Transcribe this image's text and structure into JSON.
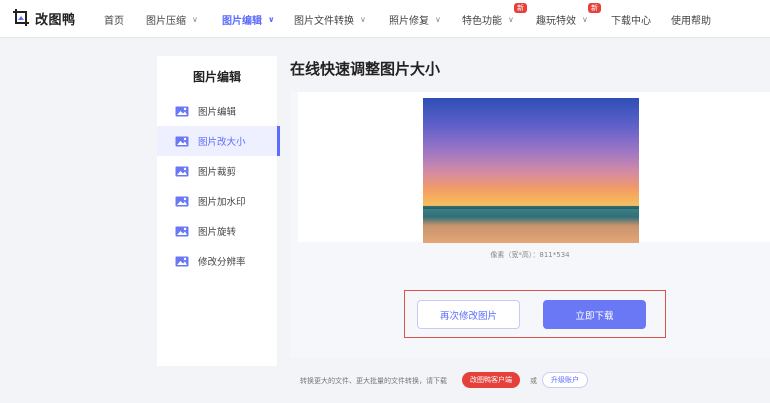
{
  "brand": {
    "name": "改图鸭"
  },
  "nav": [
    {
      "label": "首页",
      "has_menu": false
    },
    {
      "label": "图片压缩",
      "has_menu": true
    },
    {
      "label": "图片编辑",
      "has_menu": true,
      "active": true
    },
    {
      "label": "图片文件转换",
      "has_menu": true
    },
    {
      "label": "照片修复",
      "has_menu": true
    },
    {
      "label": "特色功能",
      "has_menu": true,
      "badge": "新"
    },
    {
      "label": "趣玩特效",
      "has_menu": true,
      "badge": "新"
    },
    {
      "label": "下载中心",
      "has_menu": false
    },
    {
      "label": "使用帮助",
      "has_menu": false
    }
  ],
  "sidebar": {
    "title": "图片编辑",
    "items": [
      {
        "label": "图片编辑",
        "icon": "image-icon"
      },
      {
        "label": "图片改大小",
        "icon": "image-icon",
        "active": true
      },
      {
        "label": "图片裁剪",
        "icon": "image-icon"
      },
      {
        "label": "图片加水印",
        "icon": "image-icon"
      },
      {
        "label": "图片旋转",
        "icon": "image-icon"
      },
      {
        "label": "修改分辨率",
        "icon": "image-icon"
      }
    ]
  },
  "main": {
    "title": "在线快速调整图片大小",
    "pixel_info": "像素（宽*高）：811*534",
    "buttons": {
      "again": "再次修改图片",
      "download": "立即下载"
    }
  },
  "footer": {
    "note": "转换更大的文件、更大批量的文件转换，请下载",
    "client_button": "改图鸭客户端",
    "or": "或",
    "upgrade_button": "升级账户"
  },
  "colors": {
    "accent": "#5b6cff",
    "badge": "#e5413a",
    "highlight_border": "#d9534f"
  }
}
